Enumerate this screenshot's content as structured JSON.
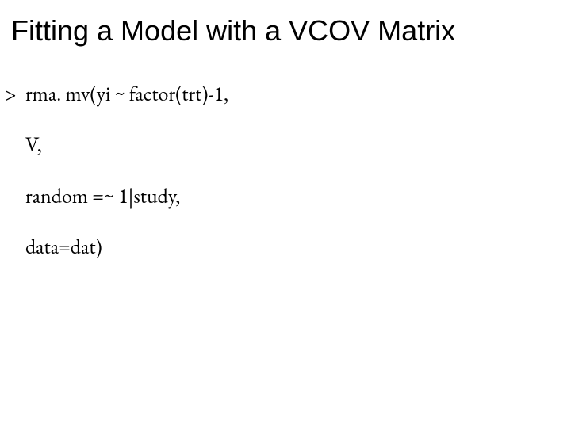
{
  "title": "Fitting a Model with a VCOV Matrix",
  "code": {
    "prompt": ">",
    "line1": "rma. mv(yi ~ factor(trt)-1,",
    "line2": "V,",
    "line3": "random =~ 1|study,",
    "line4": "data=dat)"
  }
}
